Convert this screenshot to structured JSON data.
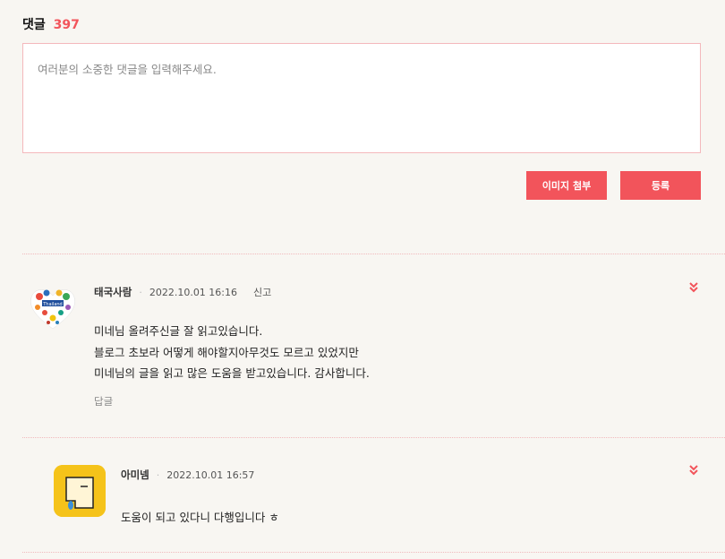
{
  "header": {
    "label": "댓글",
    "count": "397"
  },
  "comment_box": {
    "placeholder": "여러분의 소중한 댓글을 입력해주세요."
  },
  "buttons": {
    "image": "이미지 첨부",
    "submit": "등록"
  },
  "comments": [
    {
      "author": "태국사람",
      "date": "2022.10.01 16:16",
      "report": "신고",
      "lines": [
        "미네님 올려주신글 잘 읽고있습니다.",
        "블로그 초보라 어떻게 해야할지아무것도 모르고 있었지만",
        "미네님의 글을 읽고 많은 도움을 받고있습니다. 감사합니다."
      ],
      "reply": "답글"
    },
    {
      "author": "아미넴",
      "date": "2022.10.01 16:57",
      "lines": [
        "도움이 되고 있다니 다행입니다 ㅎ"
      ]
    }
  ],
  "colors": {
    "accent": "#f2545b",
    "border": "#f4b8bc"
  }
}
